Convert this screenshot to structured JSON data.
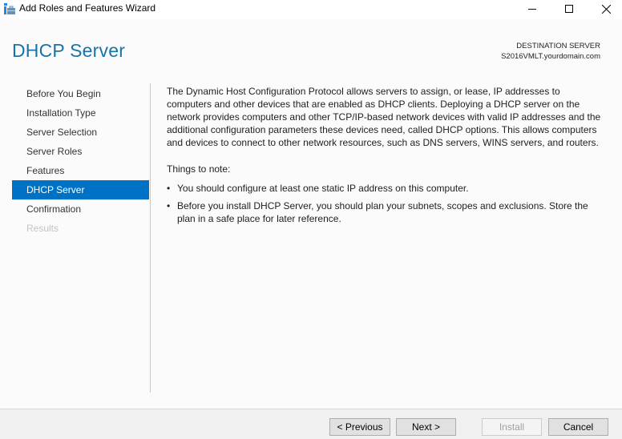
{
  "window": {
    "title": "Add Roles and Features Wizard",
    "icon": "server-manager-icon",
    "controls": [
      "minimize-icon",
      "maximize-icon",
      "close-icon"
    ]
  },
  "header": {
    "page_title": "DHCP Server",
    "destination_label": "DESTINATION SERVER",
    "destination_server": "S2016VMLT.yourdomain.com"
  },
  "sidebar": {
    "items": [
      {
        "label": "Before You Begin",
        "state": "normal"
      },
      {
        "label": "Installation Type",
        "state": "normal"
      },
      {
        "label": "Server Selection",
        "state": "normal"
      },
      {
        "label": "Server Roles",
        "state": "normal"
      },
      {
        "label": "Features",
        "state": "normal"
      },
      {
        "label": "DHCP Server",
        "state": "active"
      },
      {
        "label": "Confirmation",
        "state": "normal"
      },
      {
        "label": "Results",
        "state": "disabled"
      }
    ]
  },
  "content": {
    "description": "The Dynamic Host Configuration Protocol allows servers to assign, or lease, IP addresses to computers and other devices that are enabled as DHCP clients. Deploying a DHCP server on the network provides computers and other TCP/IP-based network devices with valid IP addresses and the additional configuration parameters these devices need, called DHCP options. This allows computers and devices to connect to other network resources, such as DNS servers, WINS servers, and routers.",
    "notes_heading": "Things to note:",
    "bullet": "•",
    "notes": [
      "You should configure at least one static IP address on this computer.",
      "Before you install DHCP Server, you should plan your subnets, scopes and exclusions. Store the plan in a safe place for later reference."
    ]
  },
  "footer": {
    "previous_label": "< Previous",
    "next_label": "Next >",
    "install_label": "Install",
    "cancel_label": "Cancel"
  },
  "colors": {
    "accent": "#0072c6",
    "title": "#1a73a8",
    "disabled_text": "#c4c4c4"
  }
}
